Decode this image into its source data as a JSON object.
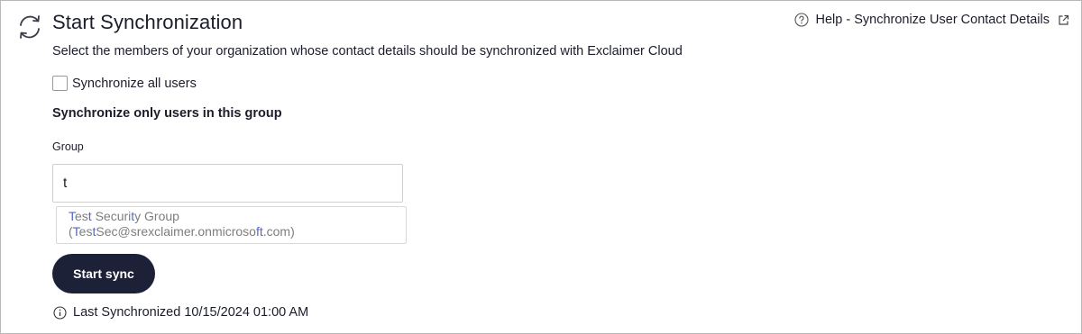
{
  "header": {
    "title": "Start Synchronization",
    "subtitle": "Select the members of your organization whose contact details should be synchronized with Exclaimer Cloud",
    "help_link": "Help - Synchronize User Contact Details",
    "icons": {
      "title": "sync-icon",
      "help": "question-circle-icon",
      "external": "external-link-icon"
    }
  },
  "sync_all": {
    "label": "Synchronize all users",
    "checked": false
  },
  "group_section": {
    "heading": "Synchronize only users in this group",
    "field_label": "Group",
    "input_value": "t",
    "suggestions": [
      {
        "name_parts": [
          {
            "text": "T",
            "match": true
          },
          {
            "text": "es",
            "match": false
          },
          {
            "text": "t",
            "match": true
          },
          {
            "text": " Securi",
            "match": false
          },
          {
            "text": "t",
            "match": true
          },
          {
            "text": "y Group",
            "match": false
          }
        ],
        "email_parts": [
          {
            "text": "(",
            "match": false
          },
          {
            "text": "T",
            "match": true
          },
          {
            "text": "es",
            "match": false
          },
          {
            "text": "t",
            "match": true
          },
          {
            "text": "Sec@srexclaimer.onmicroso",
            "match": false
          },
          {
            "text": "ft",
            "match": true
          },
          {
            "text": ".com)",
            "match": false
          }
        ]
      }
    ]
  },
  "actions": {
    "start_sync_label": "Start sync"
  },
  "status": {
    "last_synchronized": "Last Synchronized 10/15/2024 01:00 AM",
    "icon": "info-icon"
  },
  "colors": {
    "button_bg": "#1d2137",
    "match_highlight": "#5566c4",
    "suggestion_text": "#7d7d7d",
    "text": "#1b1d2b"
  }
}
